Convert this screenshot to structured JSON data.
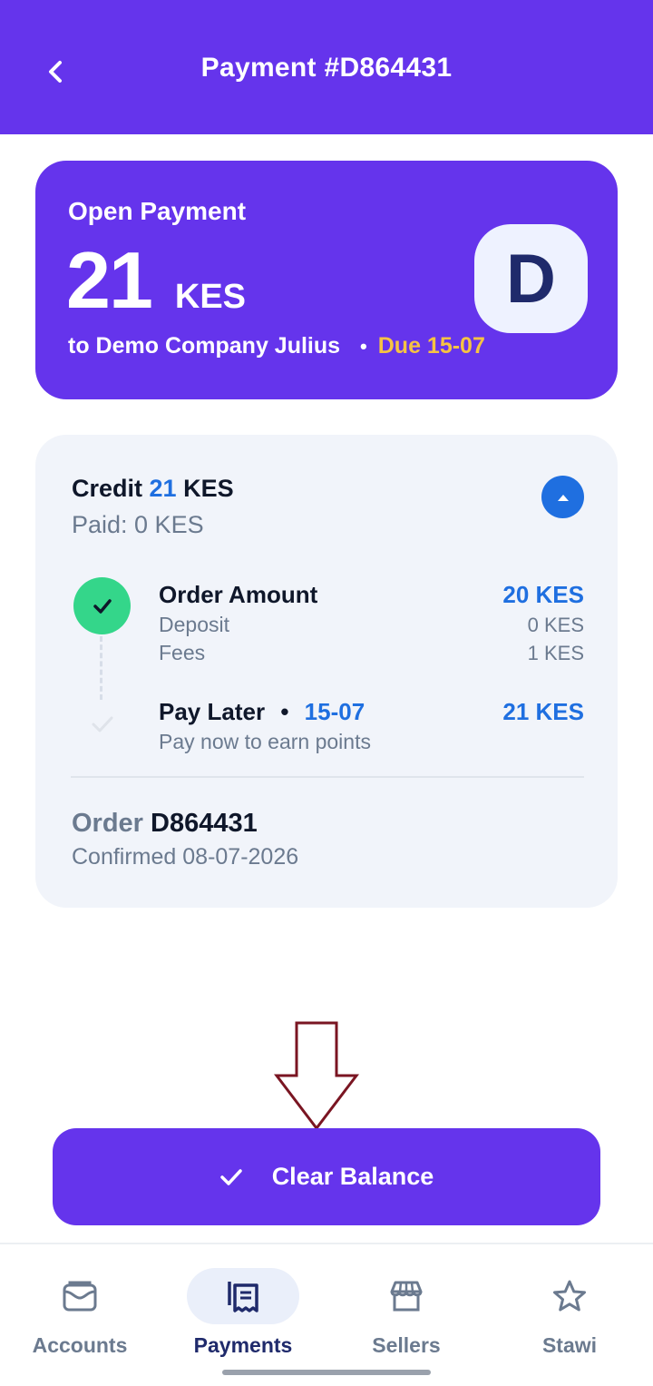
{
  "header": {
    "title": "Payment #D864431"
  },
  "summary": {
    "label": "Open Payment",
    "amount": "21",
    "currency": "KES",
    "recipient": "to Demo Company Julius",
    "due": "Due 15-07",
    "avatar_letter": "D"
  },
  "credit": {
    "prefix": "Credit",
    "amount": "21",
    "currency": "KES",
    "paid": "Paid: 0 KES",
    "order_amount": {
      "label": "Order Amount",
      "value": "20 KES"
    },
    "deposit": {
      "label": "Deposit",
      "value": "0 KES"
    },
    "fees": {
      "label": "Fees",
      "value": "1 KES"
    },
    "pay_later": {
      "label": "Pay Later",
      "date": "15-07",
      "value": "21 KES",
      "note": "Pay now to earn points"
    },
    "order_prefix": "Order",
    "order_id": "D864431",
    "confirmed": "Confirmed 08-07-2026"
  },
  "action": {
    "clear_balance": "Clear Balance"
  },
  "nav": {
    "items": [
      {
        "label": "Accounts",
        "icon": "wallet-icon"
      },
      {
        "label": "Payments",
        "icon": "receipt-icon"
      },
      {
        "label": "Sellers",
        "icon": "store-icon"
      },
      {
        "label": "Stawi",
        "icon": "star-icon"
      }
    ],
    "active": "Payments"
  },
  "colors": {
    "brand": "#6534ec",
    "accent_blue": "#1f6fe0",
    "success": "#34d68a",
    "due": "#f6c343"
  }
}
